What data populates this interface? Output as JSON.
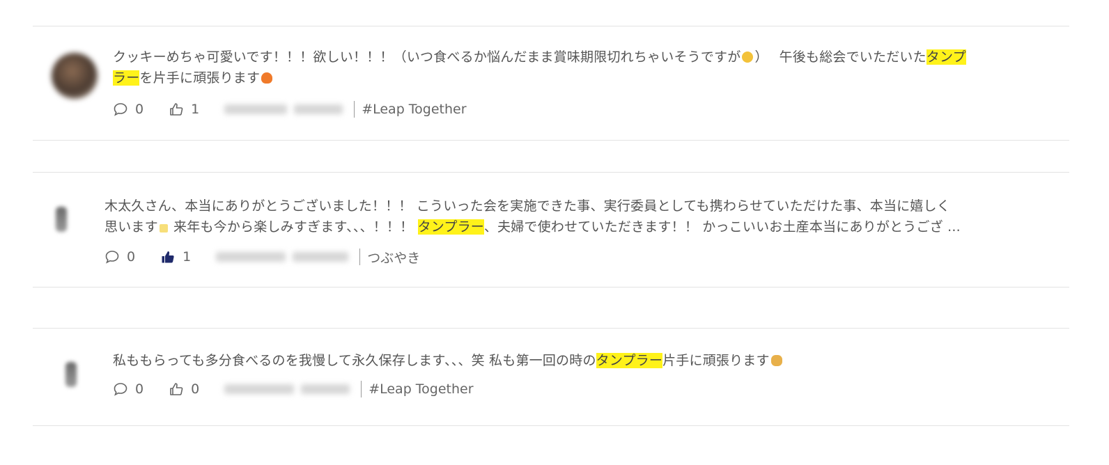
{
  "posts": [
    {
      "text_before": "クッキーめちゃ可愛いです！！！欲しい！！！（いつ食べるか悩んだまま賞味期限切れちゃいそうですが",
      "text_mid": "）　 午後も総会でいただいた",
      "highlight_1a": "タンプ",
      "highlight_1b": "ラー",
      "text_after": "を片手に頑張ります",
      "comment_count": "0",
      "like_count": "1",
      "liked": false,
      "tag": "#Leap Together"
    },
    {
      "line1": "木太久さん、本当にありがとうございました！！！ こういった会を実施できた事、実行委員としても携わらせていただけた事、本当に嬉しく",
      "line2_before": "思います",
      "line2_mid": " 来年も今から楽しみすぎます、、、！！！ ",
      "highlight": "タンプラー",
      "line2_after": "、夫婦で使わせていただきます！！ かっこいいお土産本当にありがとうござ ...",
      "comment_count": "0",
      "like_count": "1",
      "liked": true,
      "tag": "つぶやき"
    },
    {
      "text_before": "私ももらっても多分食べるのを我慢して永久保存します、、、笑 私も第一回の時の",
      "highlight": "タンプラー",
      "text_after": "片手に頑張ります",
      "comment_count": "0",
      "like_count": "0",
      "liked": false,
      "tag": "#Leap Together"
    }
  ],
  "colors": {
    "highlight": "#fff21a",
    "liked_thumb": "#1f2a6b",
    "divider": "#e3e3e3"
  },
  "icons": [
    "comment-icon",
    "thumbs-up-outline-icon",
    "thumbs-up-filled-icon"
  ]
}
